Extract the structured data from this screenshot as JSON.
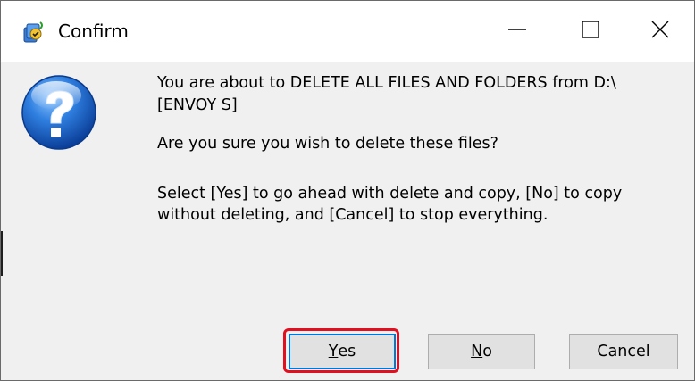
{
  "window": {
    "title": "Confirm",
    "controls": {
      "minimize": "minimize",
      "maximize": "maximize",
      "close": "close"
    }
  },
  "message": {
    "line1": "You are about to DELETE ALL FILES AND FOLDERS from D:\\",
    "line2": "[ENVOY S]",
    "line3": "Are you sure you wish to delete these files?",
    "line4": "Select [Yes] to go ahead with delete and copy, [No] to copy",
    "line5": "without deleting, and [Cancel] to stop everything."
  },
  "buttons": {
    "yes_mnemonic": "Y",
    "yes_rest": "es",
    "no_mnemonic": "N",
    "no_rest": "o",
    "cancel": "Cancel"
  },
  "icons": {
    "app": "app-icon",
    "dialog": "question-icon"
  },
  "colors": {
    "highlight": "#e01020",
    "focus_border": "#0078d7",
    "icon_blue": "#1e6fd0"
  }
}
